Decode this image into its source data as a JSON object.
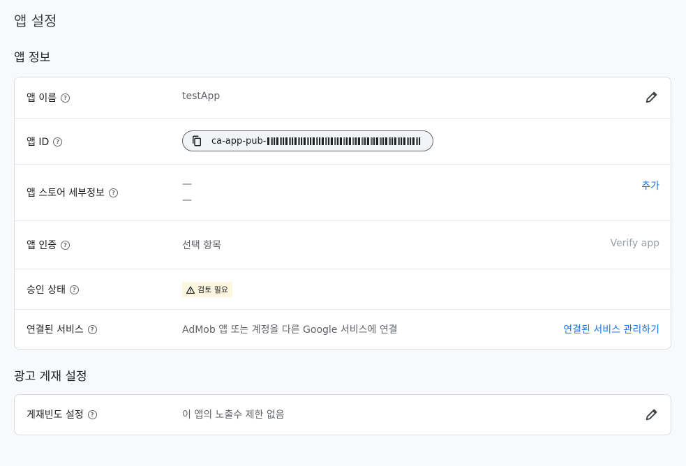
{
  "page": {
    "title": "앱 설정"
  },
  "app_info": {
    "section_title": "앱 정보",
    "rows": {
      "app_name": {
        "label": "앱 이름",
        "value": "testApp"
      },
      "app_id": {
        "label": "앱 ID",
        "value": "ca-app-pub-"
      },
      "store_details": {
        "label": "앱 스토어 세부정보",
        "values": [
          "—",
          "—"
        ],
        "action": "추가"
      },
      "app_verification": {
        "label": "앱 인증",
        "value": "선택 항목",
        "action": "Verify app"
      },
      "approval_status": {
        "label": "승인 상태",
        "badge": "검토 필요"
      },
      "linked_services": {
        "label": "연결된 서비스",
        "value": "AdMob 앱 또는 계정을 다른 Google 서비스에 연결",
        "action": "연결된 서비스 관리하기"
      }
    }
  },
  "ad_serving": {
    "section_title": "광고 게재 설정",
    "rows": {
      "frequency_capping": {
        "label": "게재빈도 설정",
        "value": "이 앱의 노출수 제한 없음"
      }
    }
  },
  "colors": {
    "link": "#1a73e8",
    "badge_bg": "#fef7e0",
    "disabled": "#9aa0a6"
  },
  "icons": {
    "help": "help-circle-icon",
    "edit": "pencil-icon",
    "copy": "copy-icon",
    "warning": "warning-triangle-icon"
  }
}
